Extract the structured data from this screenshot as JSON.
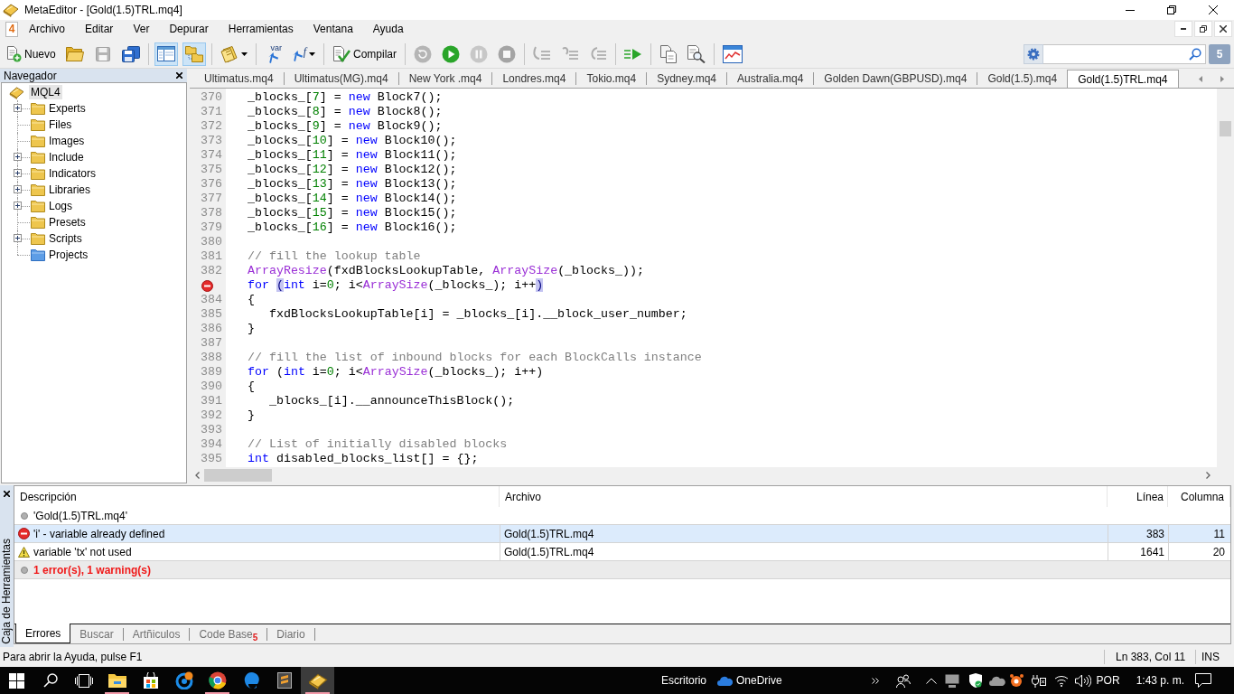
{
  "window": {
    "title": "MetaEditor - [Gold(1.5)TRL.mq4]"
  },
  "menu_bar": {
    "icon_text": "4",
    "items": [
      "Archivo",
      "Editar",
      "Ver",
      "Depurar",
      "Herramientas",
      "Ventana",
      "Ayuda"
    ]
  },
  "toolbar": {
    "groups": [
      [
        {
          "label": "Nuevo",
          "pressed": false,
          "disabled": false,
          "menu": false
        },
        {
          "pressed": false,
          "disabled": false,
          "menu": false
        },
        {
          "pressed": false,
          "disabled": true,
          "menu": false
        },
        {
          "pressed": false,
          "disabled": false,
          "menu": false
        }
      ],
      [
        {
          "pressed": true,
          "disabled": false,
          "menu": false
        },
        {
          "pressed": true,
          "disabled": false,
          "menu": false
        }
      ],
      [
        {
          "pressed": false,
          "disabled": false,
          "menu": true
        }
      ],
      [
        {
          "label": "var",
          "pressed": false,
          "disabled": false,
          "menu": false
        },
        {
          "label": "f",
          "pressed": false,
          "disabled": false,
          "menu": true
        }
      ],
      [
        {
          "label": "Compilar",
          "pressed": false,
          "disabled": false,
          "menu": false
        }
      ],
      [
        {
          "pressed": false,
          "disabled": true,
          "menu": false
        },
        {
          "pressed": false,
          "disabled": false,
          "menu": false
        },
        {
          "pressed": false,
          "disabled": true,
          "menu": false
        },
        {
          "pressed": false,
          "disabled": true,
          "menu": false
        }
      ],
      [
        {
          "pressed": false,
          "disabled": true,
          "menu": false
        },
        {
          "pressed": false,
          "disabled": true,
          "menu": false
        },
        {
          "pressed": false,
          "disabled": true,
          "menu": false
        }
      ],
      [
        {
          "pressed": false,
          "disabled": false,
          "menu": false
        }
      ],
      [
        {
          "pressed": false,
          "disabled": false,
          "menu": false
        },
        {
          "pressed": false,
          "disabled": false,
          "menu": false
        }
      ],
      [
        {
          "pressed": false,
          "disabled": false,
          "menu": false
        }
      ]
    ],
    "messages_badge": "5"
  },
  "navigator": {
    "title": "Navegador",
    "tree": {
      "label": "MQL4",
      "selected": true,
      "children": [
        {
          "label": "Experts",
          "kind": "collapsed",
          "selected": false
        },
        {
          "label": "Files",
          "kind": "leaf",
          "selected": false
        },
        {
          "label": "Images",
          "kind": "leaf",
          "selected": false
        },
        {
          "label": "Include",
          "kind": "collapsed",
          "selected": false
        },
        {
          "label": "Indicators",
          "kind": "collapsed",
          "selected": false
        },
        {
          "label": "Libraries",
          "kind": "collapsed",
          "selected": false
        },
        {
          "label": "Logs",
          "kind": "collapsed",
          "selected": false
        },
        {
          "label": "Presets",
          "kind": "leaf",
          "selected": false
        },
        {
          "label": "Scripts",
          "kind": "collapsed",
          "selected": false
        },
        {
          "label": "Projects",
          "kind": "project",
          "selected": false
        }
      ]
    }
  },
  "editor": {
    "tabs": [
      {
        "label": "Ultimatus.mq4",
        "selected": false
      },
      {
        "label": "Ultimatus(MG).mq4",
        "selected": false
      },
      {
        "label": "New York .mq4",
        "selected": false
      },
      {
        "label": "Londres.mq4",
        "selected": false
      },
      {
        "label": "Tokio.mq4",
        "selected": false
      },
      {
        "label": "Sydney.mq4",
        "selected": false
      },
      {
        "label": "Australia.mq4",
        "selected": false
      },
      {
        "label": "Golden Dawn(GBPUSD).mq4",
        "selected": false
      },
      {
        "label": "Gold(1.5).mq4",
        "selected": false
      },
      {
        "label": "Gold(1.5)TRL.mq4",
        "selected": true
      }
    ],
    "lines": [
      {
        "kind": "normal",
        "number": "370",
        "tokens": [
          {
            "text": "_blocks_[",
            "kind": "plain"
          },
          {
            "text": "7",
            "kind": "number"
          },
          {
            "text": "] = ",
            "kind": "plain"
          },
          {
            "text": "new",
            "kind": "keyword"
          },
          {
            "text": " Block7();",
            "kind": "plain"
          }
        ]
      },
      {
        "kind": "normal",
        "number": "371",
        "tokens": [
          {
            "text": "_blocks_[",
            "kind": "plain"
          },
          {
            "text": "8",
            "kind": "number"
          },
          {
            "text": "] = ",
            "kind": "plain"
          },
          {
            "text": "new",
            "kind": "keyword"
          },
          {
            "text": " Block8();",
            "kind": "plain"
          }
        ]
      },
      {
        "kind": "normal",
        "number": "372",
        "tokens": [
          {
            "text": "_blocks_[",
            "kind": "plain"
          },
          {
            "text": "9",
            "kind": "number"
          },
          {
            "text": "] = ",
            "kind": "plain"
          },
          {
            "text": "new",
            "kind": "keyword"
          },
          {
            "text": " Block9();",
            "kind": "plain"
          }
        ]
      },
      {
        "kind": "normal",
        "number": "373",
        "tokens": [
          {
            "text": "_blocks_[",
            "kind": "plain"
          },
          {
            "text": "10",
            "kind": "number"
          },
          {
            "text": "] = ",
            "kind": "plain"
          },
          {
            "text": "new",
            "kind": "keyword"
          },
          {
            "text": " Block10();",
            "kind": "plain"
          }
        ]
      },
      {
        "kind": "normal",
        "number": "374",
        "tokens": [
          {
            "text": "_blocks_[",
            "kind": "plain"
          },
          {
            "text": "11",
            "kind": "number"
          },
          {
            "text": "] = ",
            "kind": "plain"
          },
          {
            "text": "new",
            "kind": "keyword"
          },
          {
            "text": " Block11();",
            "kind": "plain"
          }
        ]
      },
      {
        "kind": "normal",
        "number": "375",
        "tokens": [
          {
            "text": "_blocks_[",
            "kind": "plain"
          },
          {
            "text": "12",
            "kind": "number"
          },
          {
            "text": "] = ",
            "kind": "plain"
          },
          {
            "text": "new",
            "kind": "keyword"
          },
          {
            "text": " Block12();",
            "kind": "plain"
          }
        ]
      },
      {
        "kind": "normal",
        "number": "376",
        "tokens": [
          {
            "text": "_blocks_[",
            "kind": "plain"
          },
          {
            "text": "13",
            "kind": "number"
          },
          {
            "text": "] = ",
            "kind": "plain"
          },
          {
            "text": "new",
            "kind": "keyword"
          },
          {
            "text": " Block13();",
            "kind": "plain"
          }
        ]
      },
      {
        "kind": "normal",
        "number": "377",
        "tokens": [
          {
            "text": "_blocks_[",
            "kind": "plain"
          },
          {
            "text": "14",
            "kind": "number"
          },
          {
            "text": "] = ",
            "kind": "plain"
          },
          {
            "text": "new",
            "kind": "keyword"
          },
          {
            "text": " Block14();",
            "kind": "plain"
          }
        ]
      },
      {
        "kind": "normal",
        "number": "378",
        "tokens": [
          {
            "text": "_blocks_[",
            "kind": "plain"
          },
          {
            "text": "15",
            "kind": "number"
          },
          {
            "text": "] = ",
            "kind": "plain"
          },
          {
            "text": "new",
            "kind": "keyword"
          },
          {
            "text": " Block15();",
            "kind": "plain"
          }
        ]
      },
      {
        "kind": "normal",
        "number": "379",
        "tokens": [
          {
            "text": "_blocks_[",
            "kind": "plain"
          },
          {
            "text": "16",
            "kind": "number"
          },
          {
            "text": "] = ",
            "kind": "plain"
          },
          {
            "text": "new",
            "kind": "keyword"
          },
          {
            "text": " Block16();",
            "kind": "plain"
          }
        ]
      },
      {
        "kind": "normal",
        "number": "380"
      },
      {
        "kind": "normal",
        "number": "381",
        "tokens": [
          {
            "text": "// fill the lookup table",
            "kind": "comment"
          }
        ]
      },
      {
        "kind": "normal",
        "number": "382",
        "tokens": [
          {
            "text": "ArrayResize",
            "kind": "function"
          },
          {
            "text": "(fxdBlocksLookupTable, ",
            "kind": "plain"
          },
          {
            "text": "ArraySize",
            "kind": "function"
          },
          {
            "text": "(_blocks_));",
            "kind": "plain"
          }
        ]
      },
      {
        "kind": "error",
        "tokens": [
          {
            "text": "for ",
            "kind": "keyword"
          },
          {
            "text": "(",
            "kind": "match"
          },
          {
            "text": "int",
            "kind": "keyword"
          },
          {
            "text": " i=",
            "kind": "plain"
          },
          {
            "text": "0",
            "kind": "number"
          },
          {
            "text": "; i<",
            "kind": "plain"
          },
          {
            "text": "ArraySize",
            "kind": "function"
          },
          {
            "text": "(_blocks_); i++",
            "kind": "plain"
          },
          {
            "text": ")",
            "kind": "match"
          }
        ]
      },
      {
        "kind": "normal",
        "number": "384",
        "tokens": [
          {
            "text": "{",
            "kind": "plain"
          }
        ]
      },
      {
        "kind": "normal",
        "number": "385",
        "tokens": [
          {
            "text": "   fxdBlocksLookupTable[i] = _blocks_[i].__block_user_number;",
            "kind": "plain"
          }
        ]
      },
      {
        "kind": "normal",
        "number": "386",
        "tokens": [
          {
            "text": "}",
            "kind": "plain"
          }
        ]
      },
      {
        "kind": "normal",
        "number": "387"
      },
      {
        "kind": "normal",
        "number": "388",
        "tokens": [
          {
            "text": "// fill the list of inbound blocks for each BlockCalls instance",
            "kind": "comment"
          }
        ]
      },
      {
        "kind": "normal",
        "number": "389",
        "tokens": [
          {
            "text": "for",
            "kind": "keyword"
          },
          {
            "text": " (",
            "kind": "plain"
          },
          {
            "text": "int",
            "kind": "keyword"
          },
          {
            "text": " i=",
            "kind": "plain"
          },
          {
            "text": "0",
            "kind": "number"
          },
          {
            "text": "; i<",
            "kind": "plain"
          },
          {
            "text": "ArraySize",
            "kind": "function"
          },
          {
            "text": "(_blocks_); i++)",
            "kind": "plain"
          }
        ]
      },
      {
        "kind": "normal",
        "number": "390",
        "tokens": [
          {
            "text": "{",
            "kind": "plain"
          }
        ]
      },
      {
        "kind": "normal",
        "number": "391",
        "tokens": [
          {
            "text": "   _blocks_[i].__announceThisBlock();",
            "kind": "plain"
          }
        ]
      },
      {
        "kind": "normal",
        "number": "392",
        "tokens": [
          {
            "text": "}",
            "kind": "plain"
          }
        ]
      },
      {
        "kind": "normal",
        "number": "393"
      },
      {
        "kind": "normal",
        "number": "394",
        "tokens": [
          {
            "text": "// List of initially disabled blocks",
            "kind": "comment"
          }
        ]
      },
      {
        "kind": "normal",
        "number": "395",
        "tokens": [
          {
            "text": "int",
            "kind": "keyword"
          },
          {
            "text": " disabled_blocks_list[] = {};",
            "kind": "plain"
          }
        ]
      }
    ]
  },
  "toolbox": {
    "title": "Caja de Herramientas",
    "columns": [
      "Descripción",
      "Archivo",
      "Línea",
      "Columna"
    ],
    "rows": [
      {
        "kind": "file",
        "description": "'Gold(1.5)TRL.mq4'",
        "selected": false
      },
      {
        "kind": "error",
        "description": "'i' - variable already defined",
        "file": "Gold(1.5)TRL.mq4",
        "line": "383",
        "column": "11",
        "selected": true
      },
      {
        "kind": "warning",
        "description": "variable 'tx' not used",
        "file": "Gold(1.5)TRL.mq4",
        "line": "1641",
        "column": "20",
        "selected": false
      },
      {
        "kind": "summary",
        "description": "1 error(s), 1 warning(s)",
        "selected": false
      }
    ],
    "tabs": [
      {
        "label": "Errores",
        "selected": true
      },
      {
        "label": "Buscar",
        "selected": false
      },
      {
        "label": "Artñiculos",
        "selected": false
      },
      {
        "label": "Code Base",
        "badge": "5",
        "selected": false
      },
      {
        "label": "Diario",
        "selected": false
      }
    ]
  },
  "status_bar": {
    "message": "Para abrir la Ayuda, pulse F1",
    "cursor_position": "Ln 383, Col 11",
    "insert_mode": "INS"
  },
  "taskbar": {
    "apps": [
      {
        "running": true,
        "active": false
      },
      {
        "running": false,
        "active": false
      },
      {
        "running": false,
        "active": false
      },
      {
        "running": true,
        "active": false
      },
      {
        "running": false,
        "active": false
      },
      {
        "running": false,
        "active": false
      },
      {
        "running": true,
        "active": true
      }
    ],
    "desktop_label": "Escritorio",
    "onedrive_label": "OneDrive",
    "language": "POR",
    "time": "1:43 p. m."
  }
}
